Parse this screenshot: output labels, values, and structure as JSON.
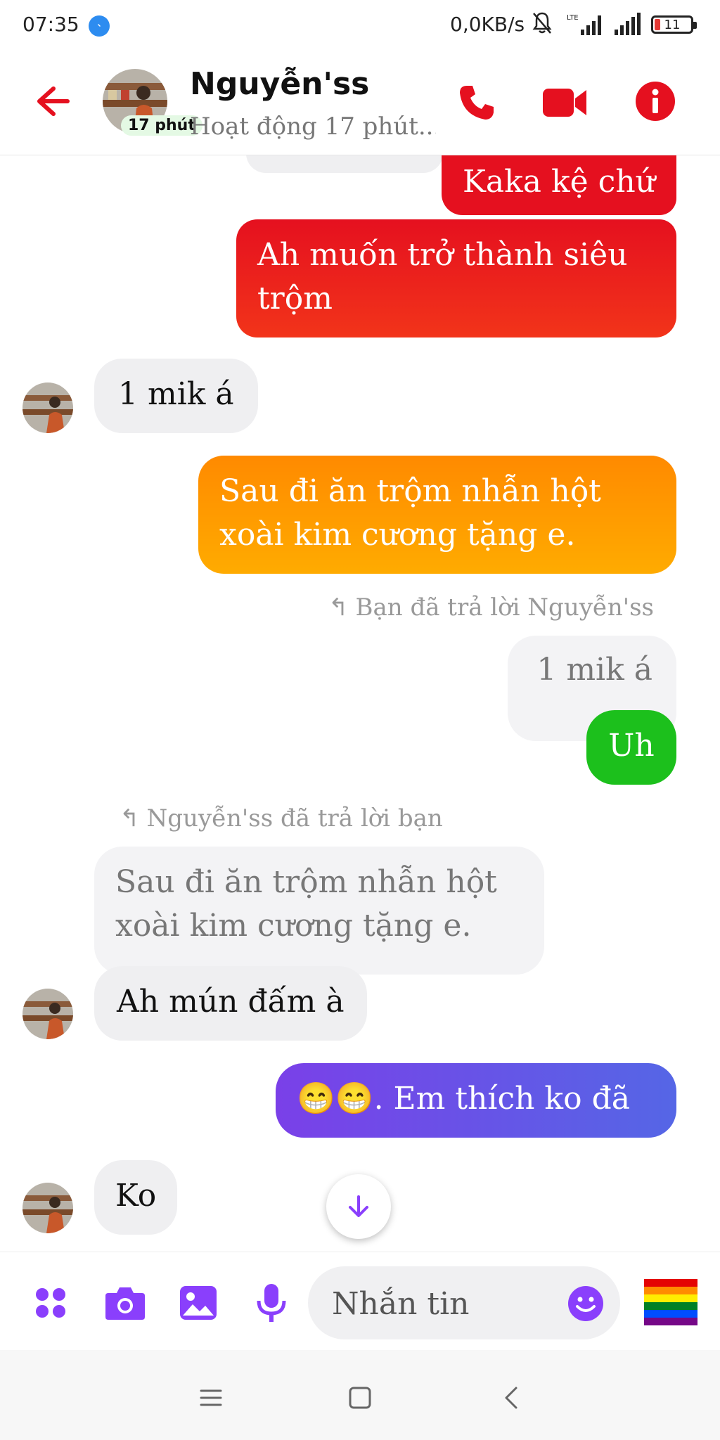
{
  "status_bar": {
    "time": "07:35",
    "net_speed": "0,0KB/s",
    "signal_label": "LTE",
    "battery": "11"
  },
  "header": {
    "contact_name": "Nguyễn'ss",
    "status_badge": "17 phút",
    "status_text": "Hoạt động 17 phút..."
  },
  "messages": [
    {
      "dir": "out",
      "text": "Kaka kệ chứ",
      "color": "#e5101f"
    },
    {
      "dir": "out",
      "text": "Ah muốn trở thành siêu trộm",
      "color": "#ef2a10"
    },
    {
      "dir": "in",
      "text": "1 mik á"
    },
    {
      "dir": "out",
      "text": "Sau đi ăn trộm nhẫn hột xoài kim cương tặng e.",
      "color": "#ff9a00"
    },
    {
      "dir": "reply_note",
      "text": "Bạn đã trả lời Nguyễn'ss"
    },
    {
      "dir": "quoted",
      "text": "1 mik á"
    },
    {
      "dir": "out",
      "text": "Uh",
      "color": "#1cc01c"
    },
    {
      "dir": "reply_note",
      "text": "Nguyễn'ss đã trả lời bạn"
    },
    {
      "dir": "quoted",
      "text": "Sau đi ăn trộm nhẫn hột xoài kim cương tặng e."
    },
    {
      "dir": "in",
      "text": "Ah mún đấm à"
    },
    {
      "dir": "out",
      "text": "😁😁. Em thích ko đã",
      "color": "#6a4fe0"
    },
    {
      "dir": "in",
      "text": "Ko"
    }
  ],
  "composer": {
    "placeholder": "Nhắn tin"
  },
  "colors": {
    "accent_red": "#e5101f",
    "accent_purple": "#8a3ffc",
    "incoming_bg": "#efeff1"
  },
  "icons": [
    "back-arrow-icon",
    "phone-icon",
    "video-camera-icon",
    "info-icon",
    "apps-icon",
    "camera-icon",
    "gallery-icon",
    "microphone-icon",
    "emoji-icon",
    "rainbow-flag-icon",
    "arrow-down-icon",
    "menu-icon",
    "home-icon",
    "back-icon"
  ]
}
